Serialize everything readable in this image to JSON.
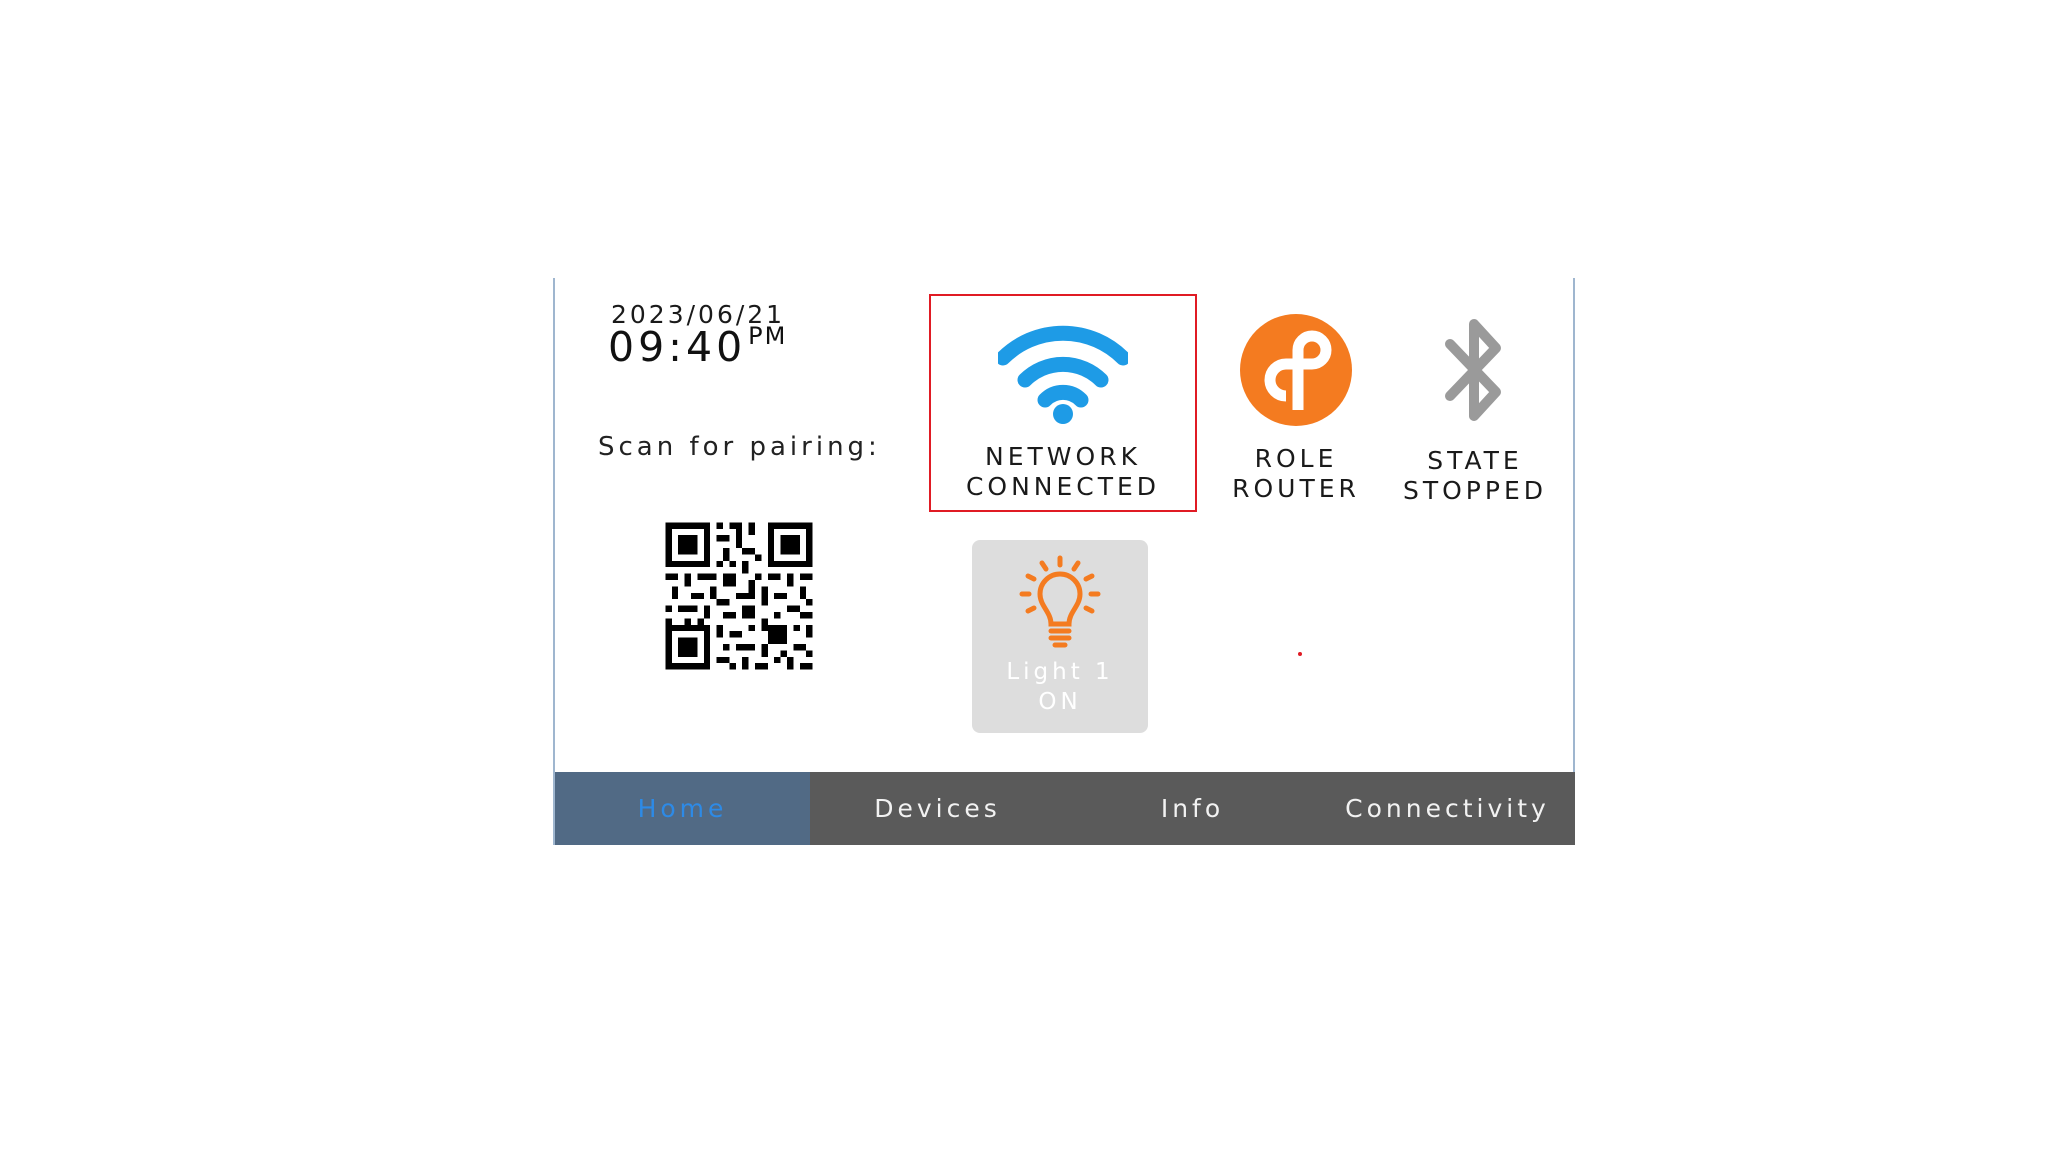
{
  "clock": {
    "date": "2023/06/21",
    "time": "09:40",
    "ampm": "PM"
  },
  "pairing": {
    "label": "Scan for pairing:",
    "qr_icon": "qr-code"
  },
  "status": {
    "network": {
      "icon": "wifi-icon",
      "line1": "NETWORK",
      "line2": "CONNECTED",
      "color": "#1e9be6",
      "highlight_color": "#e01b24"
    },
    "role": {
      "icon": "thread-icon",
      "line1": "ROLE",
      "line2": "ROUTER",
      "color": "#f47b20"
    },
    "bluetooth": {
      "icon": "bluetooth-icon",
      "line1": "STATE",
      "line2": "STOPPED",
      "color": "#9a9a9a"
    }
  },
  "devices": [
    {
      "icon": "lightbulb-icon",
      "name": "Light 1",
      "state": "ON",
      "color": "#f47b20"
    }
  ],
  "nav": {
    "tabs": [
      {
        "label": "Home",
        "active": true
      },
      {
        "label": "Devices",
        "active": false
      },
      {
        "label": "Info",
        "active": false
      },
      {
        "label": "Connectivity",
        "active": false
      }
    ],
    "active_color": "#2d8ae6",
    "bar_color": "#5a5a5a"
  }
}
